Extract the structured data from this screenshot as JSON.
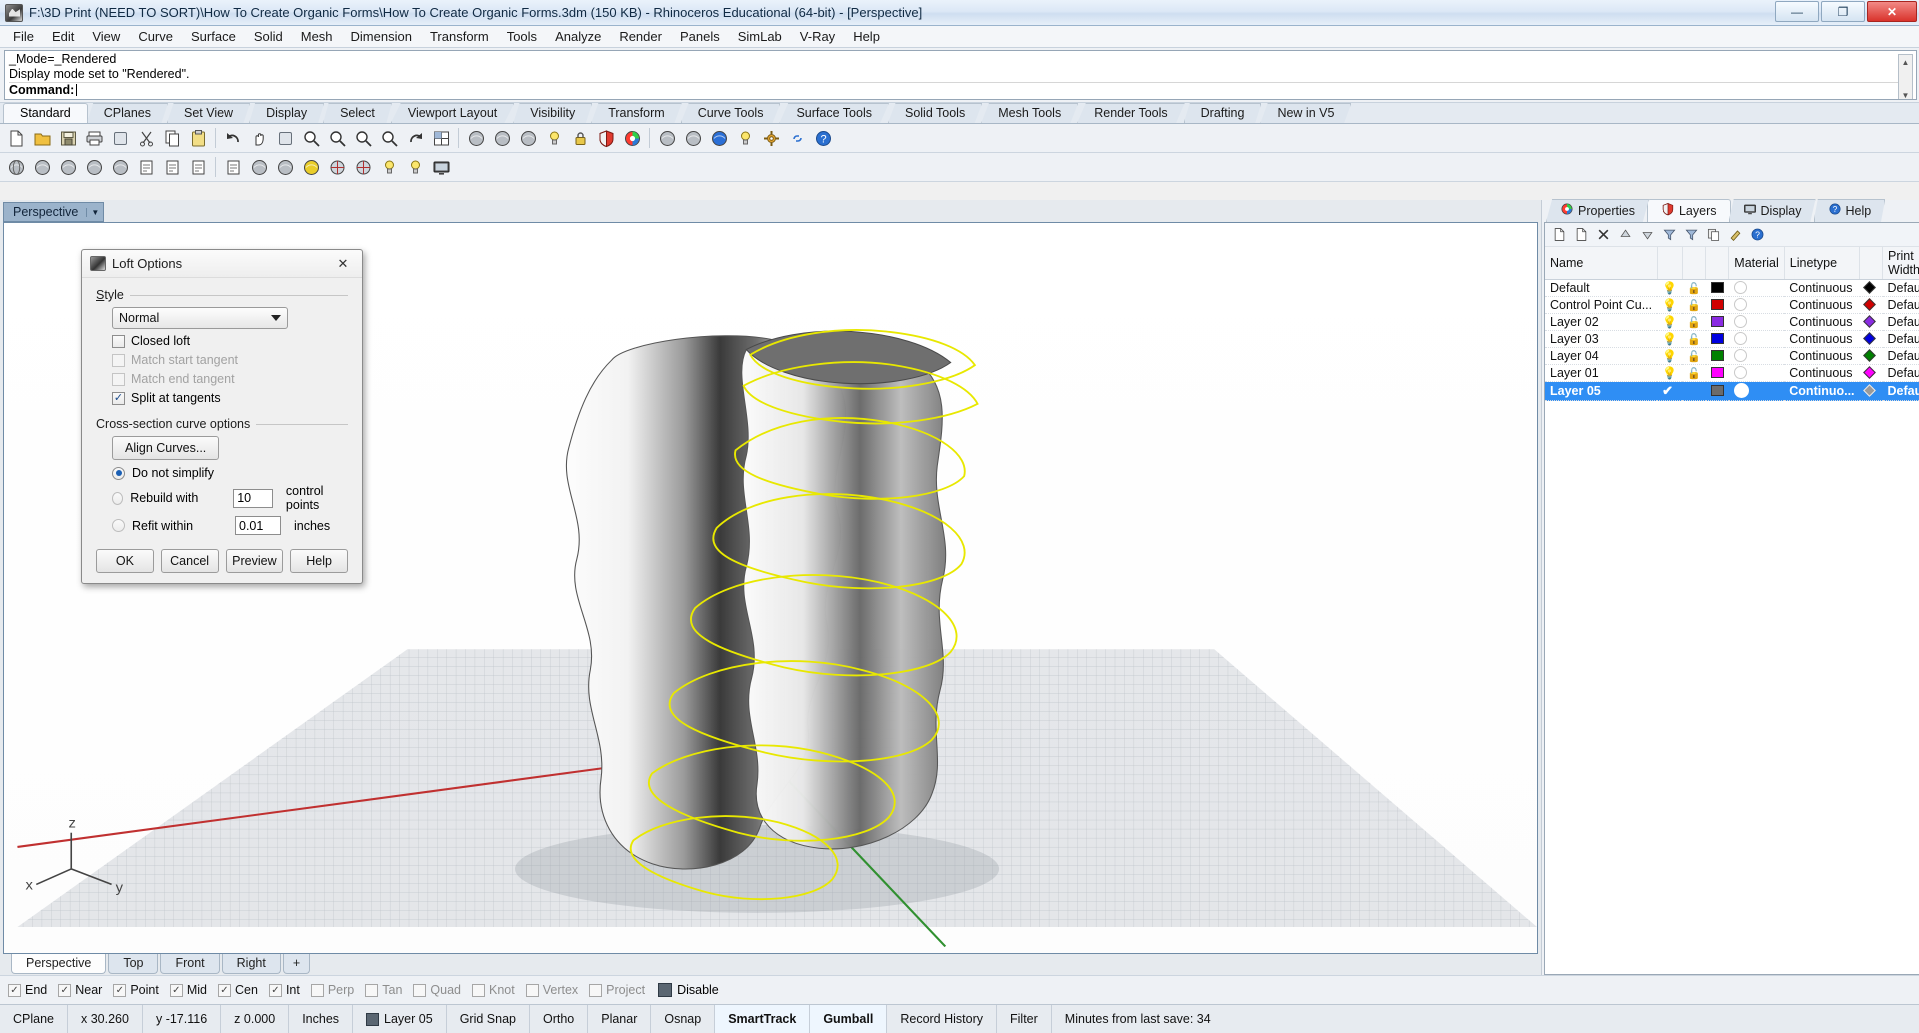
{
  "window": {
    "title": "F:\\3D Print (NEED TO SORT)\\How To Create Organic Forms\\How To Create Organic Forms.3dm (150 KB) - Rhinoceros Educational (64-bit) - [Perspective]",
    "minimize_label": "—",
    "maximize_label": "❐",
    "close_label": "✕"
  },
  "menubar": {
    "items": [
      {
        "label": "File"
      },
      {
        "label": "Edit"
      },
      {
        "label": "View"
      },
      {
        "label": "Curve"
      },
      {
        "label": "Surface"
      },
      {
        "label": "Solid"
      },
      {
        "label": "Mesh"
      },
      {
        "label": "Dimension"
      },
      {
        "label": "Transform"
      },
      {
        "label": "Tools"
      },
      {
        "label": "Analyze"
      },
      {
        "label": "Render"
      },
      {
        "label": "Panels"
      },
      {
        "label": "SimLab"
      },
      {
        "label": "V-Ray"
      },
      {
        "label": "Help"
      }
    ]
  },
  "command": {
    "history_line1": "_Mode=_Rendered",
    "history_line2": "Display mode set to \"Rendered\".",
    "prompt_label": "Command:",
    "input_value": "",
    "scroll_up": "▲",
    "scroll_down": "▼"
  },
  "toolbar_tabs": {
    "items": [
      {
        "label": "Standard",
        "active": true
      },
      {
        "label": "CPlanes",
        "active": false
      },
      {
        "label": "Set View",
        "active": false
      },
      {
        "label": "Display",
        "active": false
      },
      {
        "label": "Select",
        "active": false
      },
      {
        "label": "Viewport Layout",
        "active": false
      },
      {
        "label": "Visibility",
        "active": false
      },
      {
        "label": "Transform",
        "active": false
      },
      {
        "label": "Curve Tools",
        "active": false
      },
      {
        "label": "Surface Tools",
        "active": false
      },
      {
        "label": "Solid Tools",
        "active": false
      },
      {
        "label": "Mesh Tools",
        "active": false
      },
      {
        "label": "Render Tools",
        "active": false
      },
      {
        "label": "Drafting",
        "active": false
      },
      {
        "label": "New in V5",
        "active": false
      }
    ]
  },
  "toolbar_row1": {
    "icons": [
      "new-file-icon",
      "open-folder-icon",
      "save-icon",
      "print-icon",
      "save-as-icon",
      "cut-scissors-icon",
      "copy-icon",
      "paste-icon",
      "undo-icon",
      "pan-hand-icon",
      "rotate-view-icon",
      "zoom-in-icon",
      "zoom-window-icon",
      "zoom-extents-icon",
      "zoom-selected-icon",
      "redo-view-icon",
      "viewport-layout-icon",
      "car-render-icon",
      "render-preview-icon",
      "shade-icon",
      "spotlight-icon",
      "lock-icon",
      "layers-icon",
      "color-wheel-icon",
      "sphere-shade-icon",
      "sphere-render-icon",
      "blue-sphere-icon",
      "flashlight-icon",
      "gears-icon",
      "link-icon",
      "help-icon"
    ]
  },
  "toolbar_row2": {
    "icons": [
      "wireframe-icon",
      "shaded-icon",
      "ghosted-icon",
      "rendered-icon",
      "xray-icon",
      "technical-icon",
      "artistic-icon",
      "pen-icon",
      "pen2-icon",
      "mesh-sphere-icon",
      "halfshade-icon",
      "yellow-sphere-icon",
      "orient-icon",
      "camera-icon",
      "light-icon",
      "no-light-icon",
      "monitor-icon"
    ]
  },
  "viewport": {
    "title": "Perspective",
    "dropdown_arrow": "▼",
    "tabs": [
      {
        "label": "Perspective",
        "active": true
      },
      {
        "label": "Top",
        "active": false
      },
      {
        "label": "Front",
        "active": false
      },
      {
        "label": "Right",
        "active": false
      },
      {
        "label": "+",
        "active": false
      }
    ]
  },
  "dialog": {
    "title": "Loft Options",
    "close_label": "✕",
    "style_group_label": "Style",
    "style_selected": "Normal",
    "checkboxes": [
      {
        "label": "Closed loft",
        "checked": false,
        "disabled": false
      },
      {
        "label": "Match start tangent",
        "checked": false,
        "disabled": true
      },
      {
        "label": "Match end tangent",
        "checked": false,
        "disabled": true
      },
      {
        "label": "Split at tangents",
        "checked": true,
        "disabled": false
      }
    ],
    "cross_section_group_label": "Cross-section curve options",
    "align_curves_label": "Align Curves...",
    "radios": [
      {
        "label": "Do not simplify",
        "selected": true,
        "value": "",
        "unit": ""
      },
      {
        "label": "Rebuild with",
        "selected": false,
        "value": "10",
        "unit": "control points"
      },
      {
        "label": "Refit within",
        "selected": false,
        "value": "0.01",
        "unit": "inches"
      }
    ],
    "buttons": [
      {
        "label": "OK"
      },
      {
        "label": "Cancel"
      },
      {
        "label": "Preview"
      },
      {
        "label": "Help"
      }
    ]
  },
  "panels": {
    "tabs": [
      {
        "label": "Properties",
        "icon": "color-wheel-icon",
        "active": false
      },
      {
        "label": "Layers",
        "icon": "layers-shield-icon",
        "active": true
      },
      {
        "label": "Display",
        "icon": "monitor-icon",
        "active": false
      },
      {
        "label": "Help",
        "icon": "help-question-icon",
        "active": false
      }
    ],
    "toolbar_icons": [
      "new-layer-icon",
      "new-sublayer-icon",
      "delete-layer-icon",
      "move-up-icon",
      "move-down-icon",
      "filter-prev-icon",
      "filter-icon",
      "duplicate-icon",
      "properties-icon",
      "help-icon"
    ],
    "layers": {
      "columns": [
        "Name",
        "",
        "",
        "",
        "Material",
        "Linetype",
        "",
        "Print Width"
      ],
      "rows": [
        {
          "name": "Default",
          "on": true,
          "bulb": "blue",
          "locked": false,
          "color": "#000000",
          "material": "",
          "linetype": "Continuous",
          "print_width": "Default",
          "selected": false,
          "current": false
        },
        {
          "name": "Control Point Cu...",
          "on": true,
          "bulb": "yellow",
          "locked": false,
          "color": "#d00000",
          "material": "",
          "linetype": "Continuous",
          "print_width": "Default",
          "selected": false,
          "current": false
        },
        {
          "name": "Layer 02",
          "on": true,
          "bulb": "yellow",
          "locked": false,
          "color": "#8a2be2",
          "material": "",
          "linetype": "Continuous",
          "print_width": "Default",
          "selected": false,
          "current": false
        },
        {
          "name": "Layer 03",
          "on": true,
          "bulb": "yellow",
          "locked": false,
          "color": "#0000e0",
          "material": "",
          "linetype": "Continuous",
          "print_width": "Default",
          "selected": false,
          "current": false
        },
        {
          "name": "Layer 04",
          "on": true,
          "bulb": "yellow",
          "locked": false,
          "color": "#008000",
          "material": "",
          "linetype": "Continuous",
          "print_width": "Default",
          "selected": false,
          "current": false
        },
        {
          "name": "Layer 01",
          "on": true,
          "bulb": "yellow",
          "locked": false,
          "color": "#ff00ff",
          "material": "",
          "linetype": "Continuous",
          "print_width": "Default",
          "selected": false,
          "current": false
        },
        {
          "name": "Layer 05",
          "on": true,
          "bulb": "check",
          "locked": false,
          "color": "#6b6b6b",
          "material": "",
          "linetype": "Continuo...",
          "print_width": "Default",
          "selected": true,
          "current": true
        }
      ]
    }
  },
  "osnap": {
    "items": [
      {
        "label": "End",
        "checked": true
      },
      {
        "label": "Near",
        "checked": true
      },
      {
        "label": "Point",
        "checked": true
      },
      {
        "label": "Mid",
        "checked": true
      },
      {
        "label": "Cen",
        "checked": true
      },
      {
        "label": "Int",
        "checked": true
      },
      {
        "label": "Perp",
        "checked": false
      },
      {
        "label": "Tan",
        "checked": false
      },
      {
        "label": "Quad",
        "checked": false
      },
      {
        "label": "Knot",
        "checked": false
      },
      {
        "label": "Vertex",
        "checked": false
      },
      {
        "label": "Project",
        "checked": false
      }
    ],
    "disable_label": "Disable"
  },
  "statusbar": {
    "cells": [
      {
        "label": "CPlane",
        "highlight": false,
        "swatch": false
      },
      {
        "label": "x 30.260",
        "highlight": false,
        "swatch": false
      },
      {
        "label": "y -17.116",
        "highlight": false,
        "swatch": false
      },
      {
        "label": "z 0.000",
        "highlight": false,
        "swatch": false
      },
      {
        "label": "Inches",
        "highlight": false,
        "swatch": false
      },
      {
        "label": "Layer 05",
        "highlight": false,
        "swatch": true
      },
      {
        "label": "Grid Snap",
        "highlight": false,
        "swatch": false
      },
      {
        "label": "Ortho",
        "highlight": false,
        "swatch": false
      },
      {
        "label": "Planar",
        "highlight": false,
        "swatch": false
      },
      {
        "label": "Osnap",
        "highlight": false,
        "swatch": false
      },
      {
        "label": "SmartTrack",
        "highlight": true,
        "swatch": false
      },
      {
        "label": "Gumball",
        "highlight": true,
        "swatch": false
      },
      {
        "label": "Record History",
        "highlight": false,
        "swatch": false
      },
      {
        "label": "Filter",
        "highlight": false,
        "swatch": false
      },
      {
        "label": "Minutes from last save: 34",
        "highlight": false,
        "swatch": false
      }
    ]
  },
  "colors": {
    "accent": "#2f8ef4",
    "curve_yellow": "#e8e800",
    "axis_red": "#c03030",
    "axis_green": "#309030",
    "viewport_bg": "#ffffff",
    "ground": "#9aa0a6"
  }
}
